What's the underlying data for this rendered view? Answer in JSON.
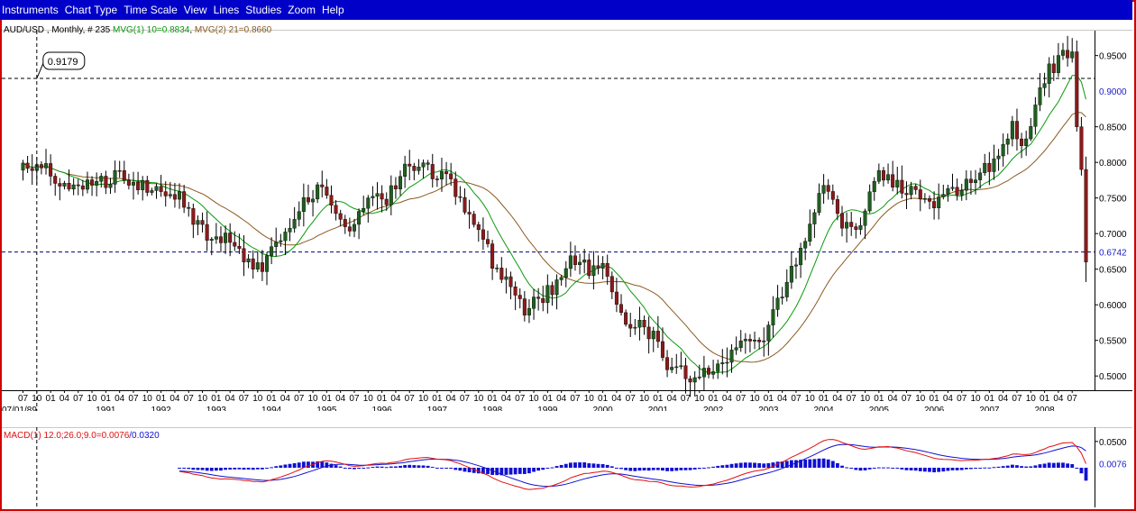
{
  "menu": [
    "Instruments",
    "Chart Type",
    "Time Scale",
    "View",
    "Lines",
    "Studies",
    "Zoom",
    "Help"
  ],
  "colors": {
    "menubar": "#0000c8",
    "frame": "#d00000",
    "up": "#1f5f1f",
    "down": "#8b1a1a",
    "mva1": "#0a9a0a",
    "mva2": "#8b5a1e",
    "macd": "#e01010",
    "signal": "#1010d0",
    "histogram": "#1010d0"
  },
  "price_header": {
    "symbol": "AUD/USD , Monthly, # 235 ",
    "mva1": "MVG(1) 10=0.8834",
    "sep": ", ",
    "mva2": "MVG(2) 21=0.8660"
  },
  "macd_header": {
    "macd": "MACD(1) 12.0;26.0;9.0=0.0076",
    "signal": "/0.0320"
  },
  "cursor_label": "0.9179",
  "highlight_labels": [
    "0.9000",
    "0.6742"
  ],
  "x_month_labels": [
    "07",
    "10",
    "01",
    "04",
    "07",
    "10",
    "01",
    "04",
    "07",
    "10",
    "01",
    "04",
    "07",
    "10",
    "01",
    "04",
    "07",
    "10",
    "01",
    "04",
    "07",
    "10",
    "01",
    "04",
    "07",
    "10",
    "01",
    "04",
    "07",
    "10",
    "01",
    "04",
    "07",
    "10",
    "01",
    "04",
    "07",
    "10",
    "01",
    "04",
    "07",
    "10",
    "01",
    "04",
    "07",
    "10",
    "01",
    "04",
    "07",
    "10",
    "01",
    "04",
    "07",
    "10",
    "01",
    "04",
    "07",
    "10",
    "01",
    "04",
    "07",
    "10",
    "01",
    "04",
    "07",
    "10",
    "01",
    "04",
    "07",
    "10",
    "01",
    "04",
    "07",
    "10",
    "01",
    "04",
    "07"
  ],
  "x_year_labels": [
    "07/01/89",
    "1991",
    "1992",
    "1993",
    "1994",
    "1995",
    "1996",
    "1997",
    "1998",
    "1999",
    "2000",
    "2001",
    "2002",
    "2003",
    "2004",
    "2005",
    "2006",
    "2007",
    "2008"
  ],
  "chart_data": [
    {
      "type": "candlestick",
      "title": "AUD/USD , Monthly, # 235",
      "x": {
        "start": "1989-07",
        "end": "2008-10",
        "unit": "month",
        "count": 232
      },
      "ylim": [
        0.48,
        0.985
      ],
      "y_ticks": [
        "0.5000",
        "0.5500",
        "0.6000",
        "0.6500",
        "0.7000",
        "0.7500",
        "0.8000",
        "0.8500",
        "0.9500"
      ],
      "horizontal_lines": [
        0.9179,
        0.6742
      ],
      "cursor": {
        "date": "1989-10",
        "value": 0.9179
      },
      "close_anchors": [
        [
          "1989-07",
          0.79
        ],
        [
          "1989-12",
          0.79
        ],
        [
          "1990-06",
          0.76
        ],
        [
          "1990-12",
          0.77
        ],
        [
          "1991-03",
          0.785
        ],
        [
          "1991-06",
          0.77
        ],
        [
          "1991-12",
          0.76
        ],
        [
          "1992-02",
          0.75
        ],
        [
          "1992-05",
          0.76
        ],
        [
          "1992-08",
          0.72
        ],
        [
          "1992-12",
          0.69
        ],
        [
          "1993-03",
          0.7
        ],
        [
          "1993-06",
          0.68
        ],
        [
          "1993-09",
          0.65
        ],
        [
          "1993-12",
          0.66
        ],
        [
          "1994-04",
          0.71
        ],
        [
          "1994-08",
          0.74
        ],
        [
          "1994-12",
          0.775
        ],
        [
          "1995-02",
          0.74
        ],
        [
          "1995-06",
          0.71
        ],
        [
          "1995-10",
          0.745
        ],
        [
          "1996-02",
          0.75
        ],
        [
          "1996-06",
          0.79
        ],
        [
          "1996-10",
          0.8
        ],
        [
          "1997-01",
          0.78
        ],
        [
          "1997-03",
          0.78
        ],
        [
          "1997-06",
          0.75
        ],
        [
          "1997-10",
          0.71
        ],
        [
          "1998-01",
          0.66
        ],
        [
          "1998-06",
          0.62
        ],
        [
          "1998-08",
          0.59
        ],
        [
          "1998-12",
          0.61
        ],
        [
          "1999-03",
          0.63
        ],
        [
          "1999-06",
          0.66
        ],
        [
          "1999-10",
          0.65
        ],
        [
          "2000-01",
          0.66
        ],
        [
          "2000-05",
          0.59
        ],
        [
          "2000-08",
          0.57
        ],
        [
          "2000-12",
          0.56
        ],
        [
          "2001-03",
          0.5
        ],
        [
          "2001-06",
          0.51
        ],
        [
          "2001-09",
          0.49
        ],
        [
          "2001-12",
          0.51
        ],
        [
          "2002-04",
          0.53
        ],
        [
          "2002-08",
          0.55
        ],
        [
          "2002-12",
          0.56
        ],
        [
          "2003-03",
          0.6
        ],
        [
          "2003-06",
          0.66
        ],
        [
          "2003-09",
          0.68
        ],
        [
          "2003-12",
          0.75
        ],
        [
          "2004-02",
          0.77
        ],
        [
          "2004-05",
          0.7
        ],
        [
          "2004-09",
          0.72
        ],
        [
          "2004-12",
          0.78
        ],
        [
          "2005-03",
          0.78
        ],
        [
          "2005-07",
          0.76
        ],
        [
          "2005-10",
          0.75
        ],
        [
          "2006-01",
          0.74
        ],
        [
          "2006-05",
          0.76
        ],
        [
          "2006-08",
          0.77
        ],
        [
          "2006-12",
          0.79
        ],
        [
          "2007-03",
          0.8
        ],
        [
          "2007-06",
          0.85
        ],
        [
          "2007-08",
          0.82
        ],
        [
          "2007-11",
          0.88
        ],
        [
          "2008-02",
          0.93
        ],
        [
          "2008-05",
          0.95
        ],
        [
          "2008-07",
          0.96
        ],
        [
          "2008-08",
          0.85
        ],
        [
          "2008-09",
          0.79
        ],
        [
          "2008-10",
          0.66
        ]
      ],
      "series": [
        {
          "name": "MVG(1) 10",
          "last": 0.8834
        },
        {
          "name": "MVG(2) 21",
          "last": 0.866
        }
      ]
    },
    {
      "type": "line+bar",
      "title": "MACD(1) 12.0;26.0;9.0",
      "ylim": [
        -0.06,
        0.06
      ],
      "y_ticks": [
        "0.0500"
      ],
      "highlight_value": "0.0076",
      "series": [
        {
          "name": "MACD",
          "last": 0.0076
        },
        {
          "name": "Signal",
          "last": 0.032
        },
        {
          "name": "Histogram"
        }
      ]
    }
  ]
}
